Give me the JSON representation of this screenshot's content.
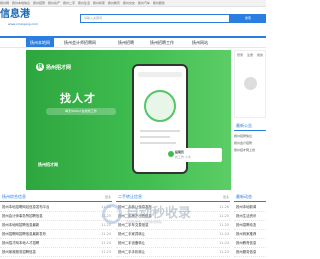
{
  "topbar": {
    "links": [
      "扬州网",
      "扬州本地信息",
      "扬州招聘",
      "扬州房产",
      "扬州二手",
      "扬州生活",
      "扬州商家",
      "扬州教育",
      "扬州交友",
      "扬州汽车",
      "扬州服务"
    ]
  },
  "header": {
    "logo_text": "信息港",
    "logo_sub": "www.xinxigang.com",
    "search_placeholder": "请输入关键词",
    "search_button": "搜索"
  },
  "nav": {
    "items": [
      "扬州本地网",
      "扬州会计师招聘网",
      "扬州招聘",
      "扬州招聘工作",
      "扬州网站"
    ]
  },
  "banner": {
    "brand_badge": "快",
    "brand": "扬州招才网",
    "title": "找人才",
    "subtitle": "每天5000人在线找工作",
    "logo2": "扬州招才网",
    "card_title": "投简历",
    "card_sub": "找工作·人才"
  },
  "login_panel": {
    "tabs": [
      "登录",
      "注册",
      "我的"
    ]
  },
  "notice": {
    "title": "最新公告",
    "items": [
      "扬州招聘信息",
      "扬州会计招聘",
      "扬州招才网上线"
    ]
  },
  "sections": [
    {
      "title": "扬州综合信息",
      "more": "更多",
      "rows": [
        {
          "text": "扬州本地招聘网站信息发布平台",
          "date": "11-26"
        },
        {
          "text": "扬州会计师事务所招聘信息",
          "date": "11-25"
        },
        {
          "text": "扬州本地网招聘信息最新",
          "date": "11-25"
        },
        {
          "text": "扬州招聘网招聘信息最新发布",
          "date": "11-24"
        },
        {
          "text": "扬州招才网本地人才招聘",
          "date": "11-24"
        },
        {
          "text": "扬州家政服务招聘信息",
          "date": "11-23"
        }
      ]
    },
    {
      "title": "二手转让信息",
      "more": "更多",
      "rows": [
        {
          "text": "扬州二手转让信息发布",
          "date": "11-26"
        },
        {
          "text": "扬州二手房产出售信息",
          "date": "11-25"
        },
        {
          "text": "扬州二手车交易信息",
          "date": "11-25"
        },
        {
          "text": "扬州二手家具转让",
          "date": "11-24"
        },
        {
          "text": "扬州二手设备转让",
          "date": "11-24"
        },
        {
          "text": "扬州二手手机转让",
          "date": "11-23"
        }
      ]
    },
    {
      "title": "最新动态",
      "more": "更多",
      "rows": [
        {
          "text": "扬州本地新闻",
          "date": ""
        },
        {
          "text": "扬州生活资讯",
          "date": ""
        },
        {
          "text": "扬州招聘动态",
          "date": ""
        },
        {
          "text": "扬州商家推荐",
          "date": ""
        },
        {
          "text": "扬州教育信息",
          "date": ""
        },
        {
          "text": "扬州服务信息",
          "date": ""
        }
      ]
    }
  ],
  "watermark": {
    "title": "自动秒收录",
    "sub": "自动秒收录 · 自动收录网站"
  }
}
